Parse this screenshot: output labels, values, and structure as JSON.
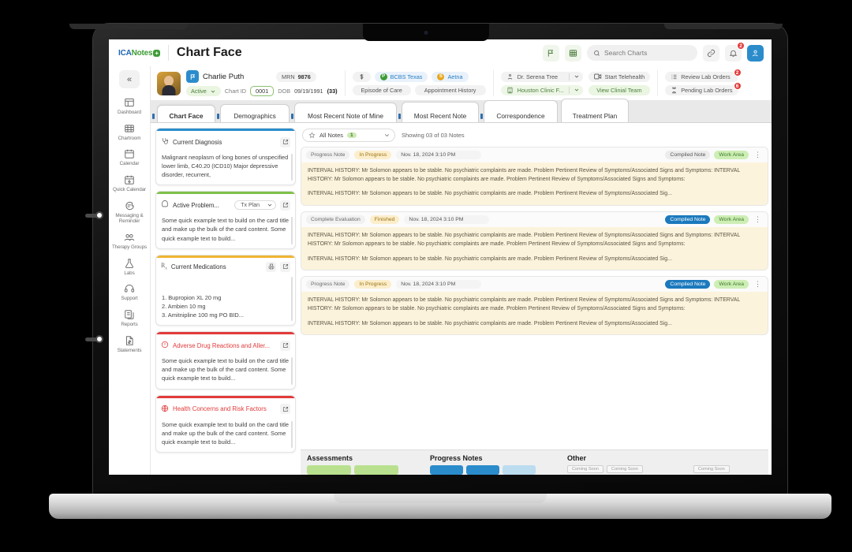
{
  "app": {
    "logo": {
      "part1": "ICA",
      "part2": "Notes",
      "plus": "+"
    },
    "page_title": "Chart Face"
  },
  "topbar": {
    "flag_icon": "flag-icon",
    "grid_icon": "settings-sliders-icon",
    "search_placeholder": "Search Charts",
    "link_icon": "link-icon",
    "bell_icon": "bell-icon",
    "bell_badge": "2",
    "user_icon": "user-avatar-icon"
  },
  "sidebar": {
    "collapse_label": "«",
    "items": [
      {
        "label": "Dashboard",
        "icon": "dashboard-icon"
      },
      {
        "label": "Chartroom",
        "icon": "chartroom-icon"
      },
      {
        "label": "Calendar",
        "icon": "calendar-icon"
      },
      {
        "label": "Quick\nCalendar",
        "icon": "quick-calendar-icon"
      },
      {
        "label": "Messaging\n& Reminder",
        "icon": "messaging-icon"
      },
      {
        "label": "Therapy\nGroups",
        "icon": "therapy-groups-icon"
      },
      {
        "label": "Labs",
        "icon": "labs-flask-icon"
      },
      {
        "label": "Support",
        "icon": "support-headset-icon"
      },
      {
        "label": "Reports",
        "icon": "reports-icon"
      },
      {
        "label": "Statements",
        "icon": "statements-icon"
      }
    ]
  },
  "patient": {
    "name": "Charlie Puth",
    "flag_icon": "patient-flag-icon",
    "mrn_label": "MRN",
    "mrn_value": "9876",
    "status": "Active",
    "chart_id_label": "Chart ID",
    "chart_id_value": "0001",
    "dob_label": "DOB",
    "dob_value": "09/19/1991",
    "dob_age": "(33)",
    "billing_icon": "dollar-icon",
    "insurance_primary": {
      "badge": "P",
      "name": "BCBS Texas"
    },
    "insurance_secondary": {
      "badge": "S",
      "name": "Aetna"
    },
    "episode_of_care": "Episode of Care",
    "appointment_history": "Appointment History",
    "provider": "Dr. Serena Tree",
    "provider_icon": "provider-icon",
    "clinic": "Houston Clinic F...",
    "clinic_icon": "clinic-building-icon",
    "start_telehealth": "Start Telehealth",
    "telehealth_icon": "video-camera-icon",
    "view_clinical_team": "View Clinial Team",
    "review_lab_orders": "Review Lab Orders",
    "review_lab_badge": "2",
    "review_lab_icon": "lab-list-icon",
    "pending_lab_orders": "Pending Lab Orders",
    "pending_lab_badge": "6",
    "pending_lab_icon": "hourglass-icon"
  },
  "tabs": [
    {
      "label": "Chart Face",
      "active": true
    },
    {
      "label": "Demographics",
      "active": false
    },
    {
      "label": "Most Recent Note of Mine",
      "active": false
    },
    {
      "label": "Most Recent Note",
      "active": false
    },
    {
      "label": "Correspondence",
      "active": false
    },
    {
      "label": "Treatment Plan",
      "active": false
    }
  ],
  "cards": [
    {
      "title": "Current Diagnosis",
      "icon": "stethoscope-icon",
      "accent": "#2b8ccb",
      "title_color": "normal",
      "body": "Malignant neoplasm of long bones of unspecified lower limb, C40.20 (ICD10) Major depressive disorder, recurrent,",
      "expand_icon": "expand-icon",
      "has_print": false,
      "select": null
    },
    {
      "title": "Active Problem...",
      "icon": "problem-icon",
      "accent": "#7ec04a",
      "title_color": "normal",
      "body": "Some quick example text to build on the card title and make up the bulk of the card content. Some quick example text to build...",
      "expand_icon": "expand-icon",
      "has_print": false,
      "select": "Tx Plan"
    },
    {
      "title": "Current Medications",
      "icon": "prescription-rx-icon",
      "accent": "#f0b433",
      "title_color": "normal",
      "body": "1. Bupropion XL 20 mg\n2. Ambien 10 mg\n3. Amitnipline 100 mg PO BID...",
      "expand_icon": "expand-icon",
      "has_print": true,
      "print_icon": "printer-icon",
      "select": null
    },
    {
      "title": "Adverse Drug Reactions and Aller...",
      "icon": "alert-icon",
      "accent": "#e23b3b",
      "title_color": "red",
      "body": "Some quick example text to build on the card title and make up the bulk of the card content. Some quick example text to build...",
      "expand_icon": "expand-icon",
      "has_print": false,
      "select": null
    },
    {
      "title": "Health Concerns and Risk Factors",
      "icon": "risk-icon",
      "accent": "#e23b3b",
      "title_color": "red",
      "body": "Some quick example text to build on the card title and make up the bulk of the card content. Some quick example text to build...",
      "expand_icon": "expand-icon",
      "has_print": false,
      "select": null
    }
  ],
  "notes_panel": {
    "filter_label": "All Notes",
    "filter_badge": "1",
    "filter_icon": "star-icon",
    "showing_text": "Showing 03 of 03 Notes",
    "notes": [
      {
        "type": "Progress Note",
        "status": "In Progress",
        "date": "Nov. 18, 2024 3:10 PM",
        "compiled_label": "Compiled Note",
        "compiled_active": false,
        "work_area_label": "Work Area",
        "menu_icon": "kebab-menu-icon",
        "paragraph1": "INTERVAL HISTORY: Mr Solomon appears to be stable. No psychiatric complaints are made. Problem Pertinent Review of Symptoms/Associated Signs and Symptoms: INTERVAL HISTORY: Mr Solomon appears to be stable. No psychiatric complaints are made. Problem Pertinent Review of Symptoms/Associated Signs and Symptoms:",
        "paragraph2": "INTERVAL HISTORY: Mr Solomon appears to be stable. No psychiatric complaints are made. Problem Pertinent Review of Symptoms/Associated Sig..."
      },
      {
        "type": "Complete Evaluation",
        "status": "Finished",
        "date": "Nov. 18, 2024 3:10 PM",
        "compiled_label": "Compiled Note",
        "compiled_active": true,
        "work_area_label": "Work Area",
        "menu_icon": "kebab-menu-icon",
        "paragraph1": "INTERVAL HISTORY: Mr Solomon appears to be stable. No psychiatric complaints are made. Problem Pertinent Review of Symptoms/Associated Signs and Symptoms: INTERVAL HISTORY: Mr Solomon appears to be stable. No psychiatric complaints are made. Problem Pertinent Review of Symptoms/Associated Signs and Symptoms:",
        "paragraph2": "INTERVAL HISTORY: Mr Solomon appears to be stable. No psychiatric complaints are made. Problem Pertinent Review of Symptoms/Associated Sig..."
      },
      {
        "type": "Progress Note",
        "status": "In Progress",
        "date": "Nov. 18, 2024 3:10 PM",
        "compiled_label": "Compiled Note",
        "compiled_active": true,
        "work_area_label": "Work Area",
        "menu_icon": "kebab-menu-icon",
        "paragraph1": "INTERVAL HISTORY: Mr Solomon appears to be stable. No psychiatric complaints are made. Problem Pertinent Review of Symptoms/Associated Signs and Symptoms: INTERVAL HISTORY: Mr Solomon appears to be stable. No psychiatric complaints are made. Problem Pertinent Review of Symptoms/Associated Signs and Symptoms:",
        "paragraph2": "INTERVAL HISTORY: Mr Solomon appears to be stable. No psychiatric complaints are made. Problem Pertinent Review of Symptoms/Associated Sig..."
      }
    ]
  },
  "bottom": {
    "col1_title": "Assessments",
    "col2_title": "Progress Notes",
    "col3_title": "Other",
    "coming_soon": "Coming Soon"
  }
}
